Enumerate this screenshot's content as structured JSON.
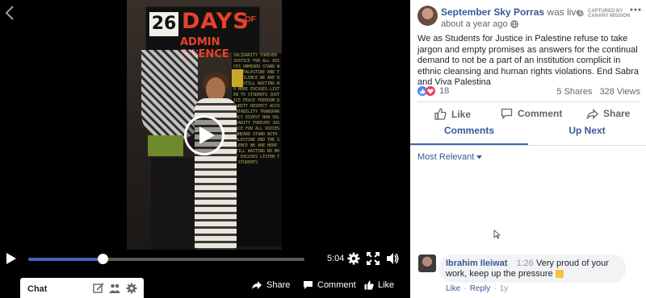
{
  "video": {
    "poster": {
      "number": "26",
      "days": "DAYS",
      "of": "OF",
      "subtitle": "ADMIN SILENCE"
    },
    "time": "5:04",
    "progress": 0.27
  },
  "bottom_bar": {
    "chat_label": "Chat",
    "share_label": "Share",
    "comment_label": "Comment",
    "like_label": "Like"
  },
  "post": {
    "author": "September Sky Porras",
    "status": "was live.",
    "time": "about a year ago",
    "badge_line1": "CAPTURED BY",
    "badge_line2": "CANARY MISSION",
    "body": "We as Students for Justice in Palestine refuse to take jargon and empty promises as answers for the continual demand to not be a part of an institution complicit in ethnic cleansing and human rights violations. End Sabra and Viva Palestina",
    "reaction_count": "18",
    "shares": "5 Shares",
    "views": "328 Views"
  },
  "actions": {
    "like": "Like",
    "comment": "Comment",
    "share": "Share"
  },
  "tabs": {
    "comments": "Comments",
    "up_next": "Up Next"
  },
  "sort_label": "Most Relevant",
  "comment": {
    "name": "Ibrahim Ileiwat",
    "time": "1:26",
    "text": "Very proud of your work, keep up the pressure",
    "like": "Like",
    "reply": "Reply",
    "age": "1y"
  },
  "colors": {
    "link": "#365899",
    "accent": "#4267b2",
    "poster_red": "#e8412a"
  },
  "board_text": "SOLIDARITY FOREVER JUSTICE FOR ALL VOICES UNHEARD STAND WITH PALESTINE END THE SILENCE WE ARE HERE STILL WAITING NO MORE EXCUSES LISTEN TO STUDENTS JUSTICE PEACE FREEDOM DIGNITY RESPECT ACCOUNTABILITY TRANSPARENCY DIVEST NOW SOLIDARITY FOREVER JUSTICE FOR ALL VOICES UNHEARD STAND WITH PALESTINE END THE SILENCE WE ARE HERE STILL WAITING NO MORE EXCUSES LISTEN TO STUDENTS"
}
